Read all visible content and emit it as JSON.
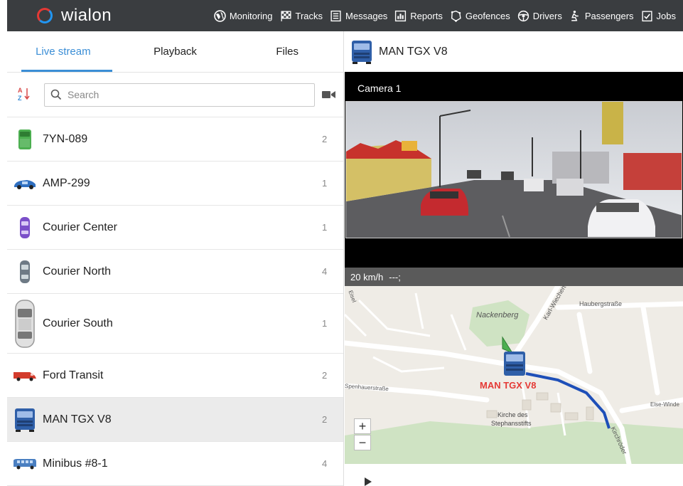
{
  "app": {
    "name": "wialon"
  },
  "nav": [
    {
      "label": "Monitoring",
      "icon": "globe-icon"
    },
    {
      "label": "Tracks",
      "icon": "flag-icon"
    },
    {
      "label": "Messages",
      "icon": "messages-icon"
    },
    {
      "label": "Reports",
      "icon": "reports-icon"
    },
    {
      "label": "Geofences",
      "icon": "geofence-icon"
    },
    {
      "label": "Drivers",
      "icon": "steering-wheel-icon"
    },
    {
      "label": "Passengers",
      "icon": "passenger-icon"
    },
    {
      "label": "Jobs",
      "icon": "jobs-icon"
    }
  ],
  "tabs": [
    {
      "label": "Live stream",
      "active": true
    },
    {
      "label": "Playback",
      "active": false
    },
    {
      "label": "Files",
      "active": false
    }
  ],
  "search": {
    "placeholder": "Search",
    "sort_label": "A Z"
  },
  "units": [
    {
      "name": "7YN-089",
      "count": "2",
      "icon": "green-truck-icon",
      "color": "#4caf50"
    },
    {
      "name": "AMP-299",
      "count": "1",
      "icon": "blue-car-icon",
      "color": "#2f6fc0"
    },
    {
      "name": "Courier Center",
      "count": "1",
      "icon": "purple-car-icon",
      "color": "#7b4fc9"
    },
    {
      "name": "Courier North",
      "count": "4",
      "icon": "gray-car-icon",
      "color": "#6e7a85"
    },
    {
      "name": "Courier South",
      "count": "1",
      "icon": "white-car-icon",
      "color": "#cfcfcf"
    },
    {
      "name": "Ford Transit",
      "count": "2",
      "icon": "red-van-icon",
      "color": "#d33b2c"
    },
    {
      "name": "MAN TGX V8",
      "count": "2",
      "icon": "blue-truck-icon",
      "color": "#2f5fa8",
      "selected": true
    },
    {
      "name": "Minibus #8-1",
      "count": "4",
      "icon": "minibus-icon",
      "color": "#4a7fc1"
    }
  ],
  "selected_unit": {
    "title": "MAN TGX V8"
  },
  "camera": {
    "label": "Camera 1"
  },
  "telemetry": {
    "speed": "20 km/h",
    "extra": "---;"
  },
  "map": {
    "unit_label": "MAN TGX V8",
    "labels": {
      "nackenberg": "Nackenberg",
      "haubergstrasse": "Haubergstraße",
      "karl": "Karl-Wiechert",
      "kirche": "Kirche des",
      "stephans": "Stephansstifts",
      "kirchrode": "Kirchröder",
      "else": "Else-Winde",
      "left_street": "Spenhauerstraße",
      "eisel": "Eisel"
    },
    "zoom_in": "+",
    "zoom_out": "−",
    "route_color": "#1e4fb8"
  }
}
